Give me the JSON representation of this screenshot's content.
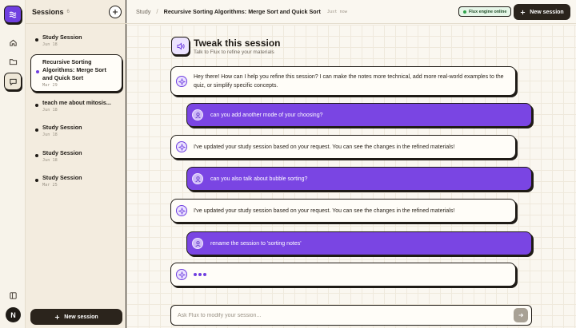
{
  "icons": {
    "logo": "waves-icon",
    "home": "home-icon",
    "folder": "folder-icon",
    "chat": "chat-icon",
    "book": "book-icon",
    "avatar_initial": "N"
  },
  "sidebar": {
    "title": "Sessions",
    "count": "6",
    "new_label": "New session",
    "items": [
      {
        "title": "Study Session",
        "date": "Jun 18",
        "active": false
      },
      {
        "title": "Recursive Sorting Algorithms: Merge Sort and Quick Sort",
        "date": "Mar 29",
        "active": true
      },
      {
        "title": "teach me about mitosis...",
        "date": "Jun 18",
        "active": false
      },
      {
        "title": "Study Session",
        "date": "Jun 18",
        "active": false
      },
      {
        "title": "Study Session",
        "date": "Jun 18",
        "active": false
      },
      {
        "title": "Study Session",
        "date": "Mar 25",
        "active": false
      }
    ]
  },
  "header": {
    "breadcrumb_root": "Study",
    "breadcrumb_current": "Recursive Sorting Algorithms: Merge Sort and Quick Sort",
    "timestamp": "Just now",
    "engine_status": "Flux engine online",
    "new_session_label": "New session"
  },
  "chat": {
    "title": "Tweak this session",
    "subtitle": "Talk to Flux to refine your materials",
    "messages": [
      {
        "role": "ai",
        "text": "Hey there! How can I help you refine this session? I can make the notes more technical, add more real-world examples to the quiz, or simplify specific concepts."
      },
      {
        "role": "user",
        "text": "can you add another mode of your choosing?"
      },
      {
        "role": "ai",
        "text": "I've updated your study session based on your request. You can see the changes in the refined materials!"
      },
      {
        "role": "user",
        "text": "can you also talk about bubble sorting?"
      },
      {
        "role": "ai",
        "text": "I've updated your study session based on your request. You can see the changes in the refined materials!"
      },
      {
        "role": "user",
        "text": "rename the session to 'sorting notes'"
      }
    ],
    "input_placeholder": "Ask Flux to modify your session..."
  },
  "colors": {
    "accent": "#7a45e3",
    "ink": "#1f1b16",
    "sidebar_bg": "#f3ecdf",
    "status_green": "#2fa24a"
  }
}
